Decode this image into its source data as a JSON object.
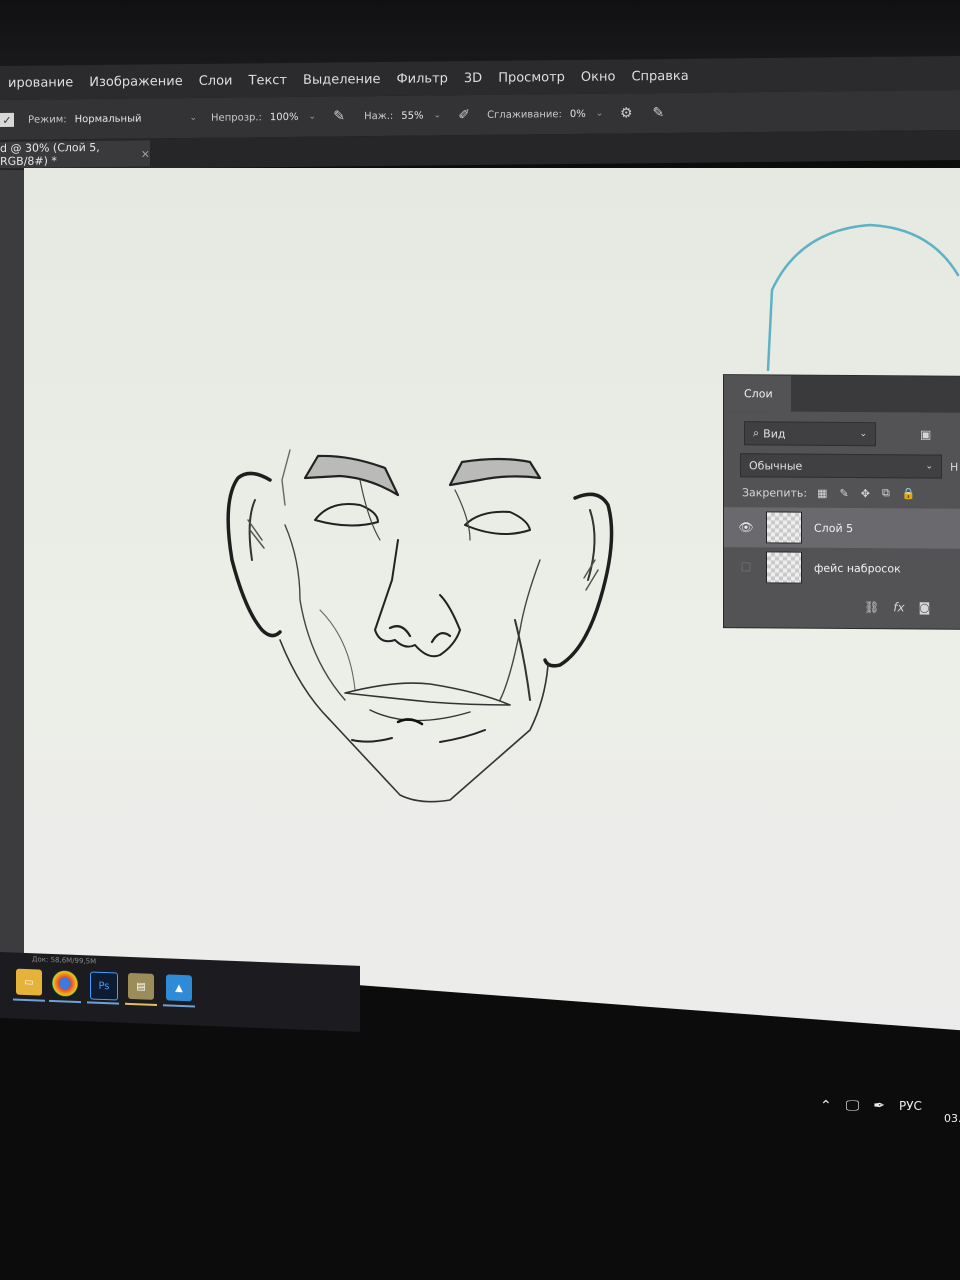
{
  "menu": [
    "ирование",
    "Изображение",
    "Слои",
    "Текст",
    "Выделение",
    "Фильтр",
    "3D",
    "Просмотр",
    "Окно",
    "Справка"
  ],
  "options": {
    "mode_label": "Режим:",
    "mode_value": "Нормальный",
    "opacity_label": "Непрозр.:",
    "opacity_value": "100%",
    "flow_label": "Наж.:",
    "flow_value": "55%",
    "smoothing_label": "Сглаживание:",
    "smoothing_value": "0%"
  },
  "document_tab": {
    "title": "d @ 30% (Слой 5, RGB/8#) *",
    "close": "×"
  },
  "layers_panel": {
    "tab": "Слои",
    "filter_label": "Вид",
    "blend_mode": "Обычные",
    "blend_extra": "Н",
    "lock_label": "Закрепить:",
    "layers": [
      {
        "name": "Слой 5",
        "visible": true,
        "selected": true
      },
      {
        "name": "фейс набросок",
        "visible": false,
        "selected": false
      }
    ],
    "footer_fx": "fx"
  },
  "taskbar": {
    "status_text": "Док: 58,6M/99,5M",
    "apps": [
      "file-explorer",
      "chrome",
      "photoshop",
      "app-4",
      "photos"
    ]
  },
  "tray": {
    "language": "РУС",
    "date_fragment": "03."
  },
  "colors": {
    "panel_bg": "#535356",
    "menubar_bg": "#2b2b2d",
    "canvas_bg": "#eceee8",
    "sketch_stroke": "#1e1e1e",
    "guide_stroke": "#5fb2c4"
  }
}
